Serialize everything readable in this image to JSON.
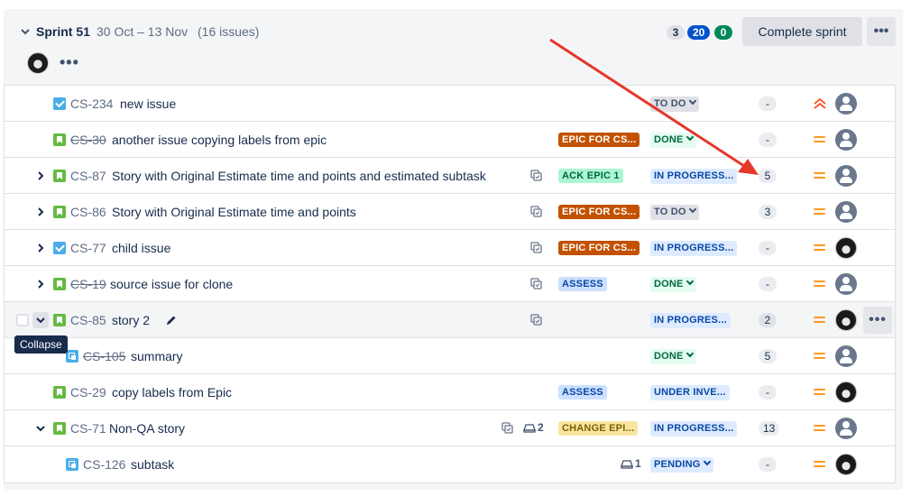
{
  "sprint": {
    "name": "Sprint 51",
    "dates": "30 Oct – 13 Nov",
    "issue_count": "(16 issues)",
    "counts": {
      "todo": "3",
      "in_progress": "20",
      "done": "0"
    },
    "complete_label": "Complete sprint",
    "menu_label": "•••",
    "members_more": "•••"
  },
  "tooltip": "Collapse",
  "issues": [
    {
      "key": "CS-234",
      "summary": "new issue",
      "type": "task",
      "status": "TO DO",
      "estimate": "-",
      "priority": "highest",
      "assignee": "default"
    },
    {
      "key": "CS-30",
      "summary": "another issue copying labels from epic",
      "type": "story",
      "strike": true,
      "epic": "EPIC FOR CS...",
      "status": "DONE",
      "estimate": "-",
      "priority": "medium",
      "assignee": "default"
    },
    {
      "key": "CS-87",
      "summary": "Story with Original Estimate time and points and estimated subtask",
      "type": "story",
      "epic": "ACK EPIC 1",
      "status": "IN PROGRESS...",
      "estimate": "5",
      "priority": "medium",
      "assignee": "default"
    },
    {
      "key": "CS-86",
      "summary": "Story with Original Estimate time and points",
      "type": "story",
      "epic": "EPIC FOR CS...",
      "status": "TO DO",
      "estimate": "3",
      "priority": "medium",
      "assignee": "default"
    },
    {
      "key": "CS-77",
      "summary": "child issue",
      "type": "task",
      "epic": "EPIC FOR CS...",
      "status": "IN PROGRESS...",
      "estimate": "-",
      "priority": "medium",
      "assignee": "photo"
    },
    {
      "key": "CS-19",
      "summary": "source issue for clone",
      "type": "story",
      "strike": true,
      "epic": "ASSESS",
      "status": "DONE",
      "estimate": "-",
      "priority": "medium",
      "assignee": "default"
    },
    {
      "key": "CS-85",
      "summary": "story 2",
      "type": "story",
      "status": "IN PROGRES...",
      "estimate": "2",
      "priority": "medium",
      "assignee": "photo",
      "row_menu": "•••"
    },
    {
      "key": "CS-105",
      "summary": "summary",
      "type": "subtask",
      "strike": true,
      "status": "DONE",
      "estimate": "5",
      "priority": "medium",
      "assignee": "default"
    },
    {
      "key": "CS-29",
      "summary": "copy labels from Epic",
      "type": "story",
      "epic": "ASSESS",
      "status": "UNDER INVE...",
      "estimate": "-",
      "priority": "medium",
      "assignee": "photo"
    },
    {
      "key": "CS-71",
      "summary": "Non-QA story",
      "type": "story",
      "epic": "CHANGE EPI...",
      "status": "IN PROGRESS...",
      "estimate": "13",
      "priority": "medium",
      "assignee": "default",
      "subtasks": "2"
    },
    {
      "key": "CS-126",
      "summary": "subtask",
      "type": "subtask",
      "status": "PENDING",
      "estimate": "-",
      "priority": "medium",
      "assignee": "photo",
      "subtasks": "1"
    }
  ],
  "colors": {
    "epic_orange": "#c25100",
    "epic_green": "#abf5d1",
    "epic_blue": "#cce0ff",
    "epic_yellow": "#f8e6a0",
    "annotation_arrow": "#e5372a"
  }
}
